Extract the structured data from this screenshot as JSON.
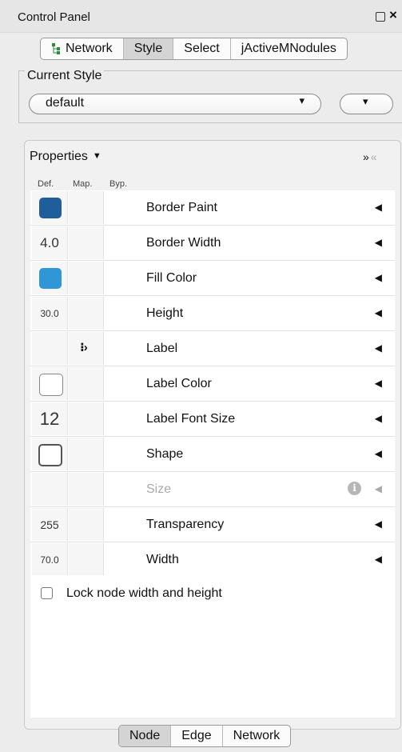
{
  "window": {
    "title": "Control Panel",
    "restore_icon": "restore-icon",
    "close_icon": "close-icon"
  },
  "tabs": [
    {
      "label": "Network",
      "icon": "network-tree-icon",
      "active": false
    },
    {
      "label": "Style",
      "active": true
    },
    {
      "label": "Select",
      "active": false
    },
    {
      "label": "jActiveMNodules",
      "active": false
    }
  ],
  "current_style": {
    "group_label": "Current Style",
    "selected": "default"
  },
  "properties": {
    "header": "Properties",
    "columns": {
      "def": "Def.",
      "map": "Map.",
      "byp": "Byp."
    },
    "rows": [
      {
        "name": "Border Paint",
        "def_color": "#1f5e9a"
      },
      {
        "name": "Border Width",
        "def_value": "4.0"
      },
      {
        "name": "Fill Color",
        "def_color": "#2f97d6"
      },
      {
        "name": "Height",
        "def_value": "30.0"
      },
      {
        "name": "Label",
        "map_icon": "passthrough-mapping-icon",
        "map_glyph": "⁝›"
      },
      {
        "name": "Label Color",
        "def_color": "#ffffff"
      },
      {
        "name": "Label Font Size",
        "def_value": "12"
      },
      {
        "name": "Shape",
        "def_shape": "round-rectangle"
      },
      {
        "name": "Size",
        "disabled": true,
        "info_glyph": "i"
      },
      {
        "name": "Transparency",
        "def_value": "255"
      },
      {
        "name": "Width",
        "def_value": "70.0"
      }
    ],
    "lock_label": "Lock node width and height",
    "lock_checked": false
  },
  "bottom_tabs": [
    {
      "label": "Node",
      "active": true
    },
    {
      "label": "Edge",
      "active": false
    },
    {
      "label": "Network",
      "active": false
    }
  ],
  "colors": {
    "accent_dark": "#1f5e9a",
    "accent_light": "#2f97d6",
    "panel_bg": "#ececec"
  }
}
